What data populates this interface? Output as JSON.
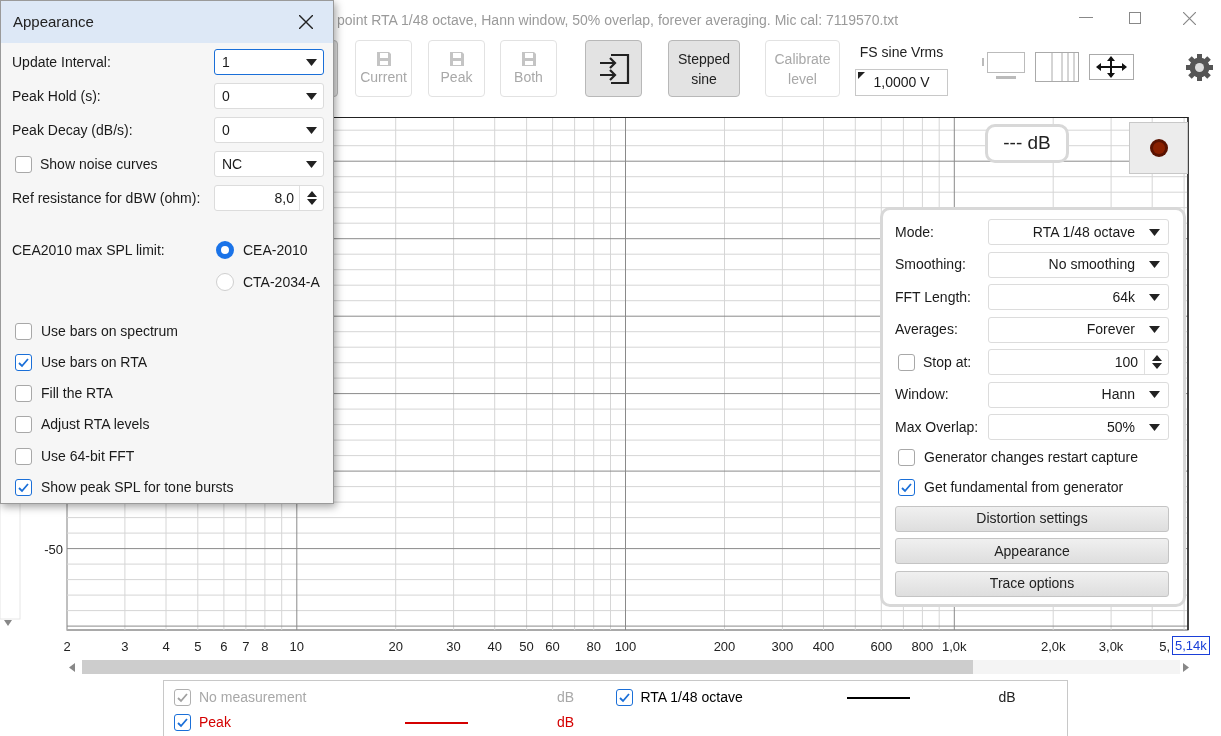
{
  "window": {
    "title": "point RTA 1/48 octave, Hann window, 50% overlap, forever averaging. Mic cal: 7119570.txt"
  },
  "toolbar": {
    "buttons": [
      {
        "kind": "hidden",
        "disabled": false
      },
      {
        "kind": "save",
        "label": "Current",
        "disabled": true
      },
      {
        "kind": "save",
        "label": "Peak",
        "disabled": true
      },
      {
        "kind": "save",
        "label": "Both",
        "disabled": true
      },
      {
        "kind": "import",
        "disabled": false
      },
      {
        "kind": "text",
        "label": "Stepped sine",
        "disabled": false
      },
      {
        "kind": "text",
        "label": "Calibrate level",
        "disabled": true
      }
    ],
    "fs_sine": {
      "label": "FS sine Vrms",
      "value": "1,0000 V"
    }
  },
  "plot": {
    "x_axis_labels": [
      "2",
      "3",
      "4",
      "5",
      "6",
      "7",
      "8",
      "10",
      "20",
      "30",
      "40",
      "50",
      "60",
      "80",
      "100",
      "200",
      "300",
      "400",
      "600",
      "800",
      "1,0k",
      "2,0k",
      "3,0k"
    ],
    "x_partial_label": "5,",
    "y_label": "-50",
    "x_cursor_label": "5,14k",
    "readout": "--- dB"
  },
  "panel": {
    "rows": [
      {
        "kind": "combo",
        "label": "Mode:",
        "value": "RTA 1/48 octave"
      },
      {
        "kind": "combo",
        "label": "Smoothing:",
        "value": "No smoothing"
      },
      {
        "kind": "combo",
        "label": "FFT Length:",
        "value": "64k"
      },
      {
        "kind": "combo",
        "label": "Averages:",
        "value": "Forever"
      },
      {
        "kind": "check_spinner",
        "label": "Stop at:",
        "checked": false,
        "value": "100"
      },
      {
        "kind": "combo",
        "label": "Window:",
        "value": "Hann"
      },
      {
        "kind": "combo",
        "label": "Max Overlap:",
        "value": "50%"
      }
    ],
    "checkboxes": [
      {
        "label": "Generator changes restart capture",
        "checked": false
      },
      {
        "label": "Get fundamental from generator",
        "checked": true
      }
    ],
    "buttons": [
      "Distortion settings",
      "Appearance",
      "Trace options"
    ]
  },
  "legend": [
    {
      "label": "No measurement",
      "checked": true,
      "disabled": true,
      "unit": "dB"
    },
    {
      "label": "RTA 1/48 octave",
      "checked": true,
      "disabled": false,
      "color": "#000000",
      "unit": "dB"
    },
    {
      "label": "Peak",
      "checked": true,
      "disabled": false,
      "color": "#d40000",
      "unit": "dB"
    }
  ],
  "dialog": {
    "title": "Appearance",
    "rows": [
      {
        "kind": "combo",
        "label": "Update Interval:",
        "value": "1",
        "focused": true
      },
      {
        "kind": "combo",
        "label": "Peak Hold (s):",
        "value": "0",
        "focused": false
      },
      {
        "kind": "combo",
        "label": "Peak Decay (dB/s):",
        "value": "0",
        "focused": false
      },
      {
        "kind": "check_combo",
        "label": "Show noise curves",
        "checked": false,
        "value": "NC",
        "focused": false
      },
      {
        "kind": "spinner",
        "label": "Ref resistance for dBW (ohm):",
        "value": "8,0",
        "focused": false
      }
    ],
    "spl_limit": {
      "label": "CEA2010 max SPL limit:",
      "options": [
        {
          "label": "CEA-2010",
          "selected": true
        },
        {
          "label": "CTA-2034-A",
          "selected": false
        }
      ]
    },
    "checkboxes": [
      {
        "label": "Use bars on spectrum",
        "checked": false
      },
      {
        "label": "Use bars on RTA",
        "checked": true
      },
      {
        "label": "Fill the RTA",
        "checked": false
      },
      {
        "label": "Adjust RTA levels",
        "checked": false
      },
      {
        "label": "Use 64-bit FFT",
        "checked": false
      },
      {
        "label": "Show peak SPL for tone bursts",
        "checked": true
      }
    ]
  }
}
